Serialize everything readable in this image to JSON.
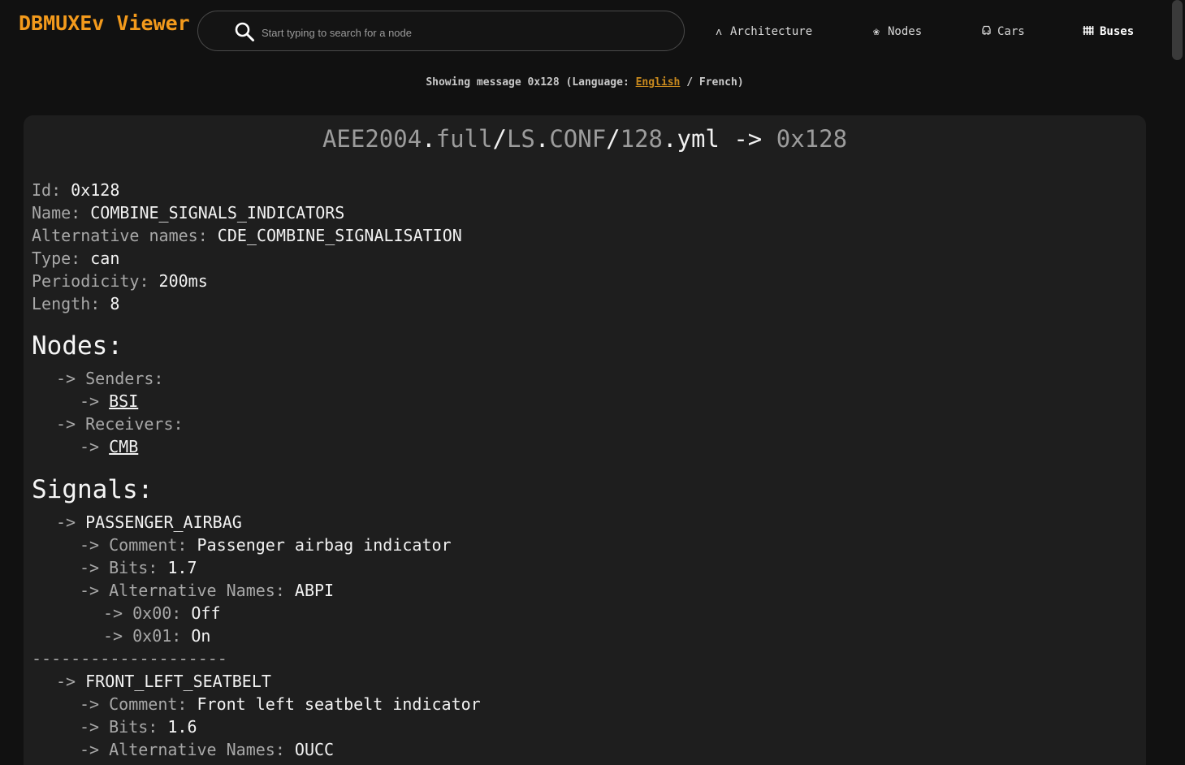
{
  "header": {
    "brand": "DBMUXEv Viewer",
    "search_placeholder": "Start typing to search for a node",
    "nav": [
      {
        "label": "Architecture",
        "icon": "ᴧ"
      },
      {
        "label": "Nodes",
        "icon": "❀"
      },
      {
        "label": "Cars",
        "icon": "⛟"
      },
      {
        "label": "Buses",
        "icon": "≡"
      }
    ],
    "active_nav": "Buses"
  },
  "subtitle": {
    "prefix": "Showing message 0x128 (Language: ",
    "lang_english": "English",
    "middle": " / ",
    "lang_french": "French",
    "suffix": ")"
  },
  "card": {
    "title_parts": [
      "AEE2004",
      ".",
      "full",
      "/",
      "LS",
      ".",
      "CONF",
      "/",
      "128",
      ".",
      "yml",
      " -> ",
      "0x128"
    ],
    "fields": [
      {
        "key": "Id: ",
        "value": "0x128"
      },
      {
        "key": "Name: ",
        "value": "COMBINE_SIGNALS_INDICATORS"
      },
      {
        "key": "Alternative names: ",
        "value": "CDE_COMBINE_SIGNALISATION"
      },
      {
        "key": "Type: ",
        "value": "can"
      },
      {
        "key": "Periodicity: ",
        "value": "200ms"
      },
      {
        "key": "Length: ",
        "value": "8"
      }
    ],
    "nodes_heading": "Nodes:",
    "senders_label": "Senders:",
    "senders": [
      "BSI"
    ],
    "receivers_label": "Receivers:",
    "receivers": [
      "CMB"
    ],
    "signals_heading": "Signals:",
    "arrow": "->",
    "separator": "--------------------",
    "signals": [
      {
        "name": "PASSENGER_AIRBAG",
        "comment_key": "Comment: ",
        "comment": "Passenger airbag indicator",
        "bits_key": "Bits: ",
        "bits": "1.7",
        "alt_key": "Alternative Names: ",
        "alt": "ABPI",
        "values": [
          {
            "key": "0x00: ",
            "value": "Off"
          },
          {
            "key": "0x01: ",
            "value": "On"
          }
        ]
      },
      {
        "name": "FRONT_LEFT_SEATBELT",
        "comment_key": "Comment: ",
        "comment": "Front left seatbelt indicator",
        "bits_key": "Bits: ",
        "bits": "1.6",
        "alt_key": "Alternative Names: ",
        "alt": "OUCC"
      }
    ]
  },
  "colors": {
    "brand": "#f39a1c",
    "link": "#c98a1e",
    "background": "#111111",
    "card": "#1e1e1e"
  }
}
